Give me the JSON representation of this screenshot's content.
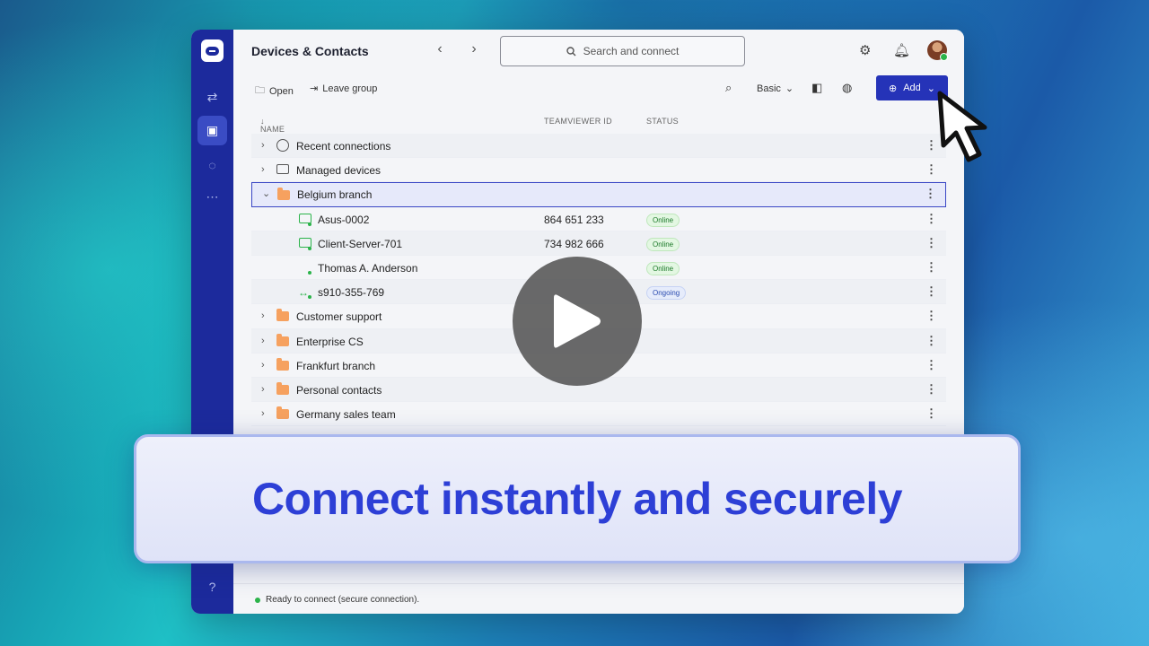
{
  "app": {
    "title": "Devices & Contacts",
    "search_placeholder": "Search and connect"
  },
  "toolbar": {
    "open_label": "Open",
    "leave_group_label": "Leave group",
    "view_mode": "Basic",
    "add_label": "Add"
  },
  "table": {
    "headers": {
      "name": "NAME",
      "id": "TEAMVIEWER ID",
      "status": "STATUS"
    },
    "rows": [
      {
        "label": "Recent connections",
        "id": "",
        "status": ""
      },
      {
        "label": "Managed devices",
        "id": "",
        "status": ""
      },
      {
        "label": "Belgium branch",
        "id": "",
        "status": ""
      },
      {
        "label": "Asus-0002",
        "id": "864 651 233",
        "status": "Online"
      },
      {
        "label": "Client-Server-701",
        "id": "734 982 666",
        "status": "Online"
      },
      {
        "label": "Thomas A. Anderson",
        "id": "",
        "status": "Online"
      },
      {
        "label": "s910-355-769",
        "id": "",
        "status": "Ongoing"
      },
      {
        "label": "Customer support",
        "id": "",
        "status": ""
      },
      {
        "label": "Enterprise CS",
        "id": "",
        "status": ""
      },
      {
        "label": "Frankfurt branch",
        "id": "",
        "status": ""
      },
      {
        "label": "Personal contacts",
        "id": "",
        "status": ""
      },
      {
        "label": "Germany sales team",
        "id": "",
        "status": ""
      }
    ]
  },
  "statusbar": {
    "text": "Ready to connect (secure connection)."
  },
  "banner": {
    "text": "Connect instantly and securely"
  },
  "colors": {
    "accent": "#2533b8",
    "rail": "#1c2a9c",
    "online": "#2bb34a",
    "folder": "#f6a15f"
  }
}
